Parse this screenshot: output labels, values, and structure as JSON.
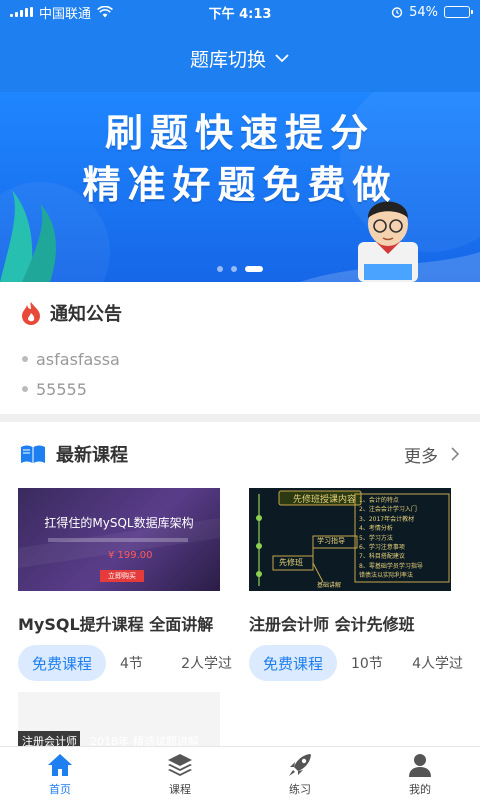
{
  "status": {
    "carrier": "中国联通",
    "time": "下午 4:13",
    "battery": "54%",
    "battery_level": 0.54
  },
  "header": {
    "title": "题库切换",
    "dropdown_icon": "chevron-down-icon"
  },
  "banner": {
    "line1": "刷题快速提分",
    "line2": "精准好题免费做",
    "slide_count": 3,
    "active_slide": 3
  },
  "notice": {
    "title": "通知公告",
    "icon": "flame-icon",
    "items": [
      "asfasfassa",
      "55555"
    ]
  },
  "courses": {
    "title": "最新课程",
    "icon": "book-icon",
    "more_label": "更多",
    "items": [
      {
        "title": "MySQL提升课程 全面讲解",
        "tag": "免费课程",
        "lessons": "4节",
        "learners": "2人学过",
        "thumb_text": "扛得住的MySQL数据库架构",
        "thumb_price": "¥ 199.00",
        "thumb_button": "立即购买"
      },
      {
        "title": "注册会计师 会计先修班",
        "tag": "免费课程",
        "lessons": "10节",
        "learners": "4人学过",
        "thumb_title": "先修班授课内容",
        "thumb_node": "先修班",
        "thumb_branch1": "学习指导",
        "thumb_branch2": "基础讲解",
        "thumb_items": [
          "1、会计的特点",
          "2、注会会计学习入门",
          "3、2017年会计教材",
          "4、考情分析",
          "5、学习方法",
          "6、学习注意事项",
          "7、科目搭配建议",
          "8、零基础学员学习指导"
        ],
        "thumb_footer": "错债法以实际利率法"
      },
      {
        "thumb_left": "注册会计师",
        "thumb_right": "2018年-精选试题讲解"
      }
    ]
  },
  "tabbar": {
    "items": [
      {
        "label": "首页",
        "icon": "home-icon",
        "active": true
      },
      {
        "label": "课程",
        "icon": "layers-icon",
        "active": false
      },
      {
        "label": "练习",
        "icon": "rocket-icon",
        "active": false
      },
      {
        "label": "我的",
        "icon": "user-icon",
        "active": false
      }
    ]
  },
  "colors": {
    "primary": "#1e7ff0",
    "tag_bg": "#dbeafe",
    "notice_icon": "#e84a3a"
  }
}
